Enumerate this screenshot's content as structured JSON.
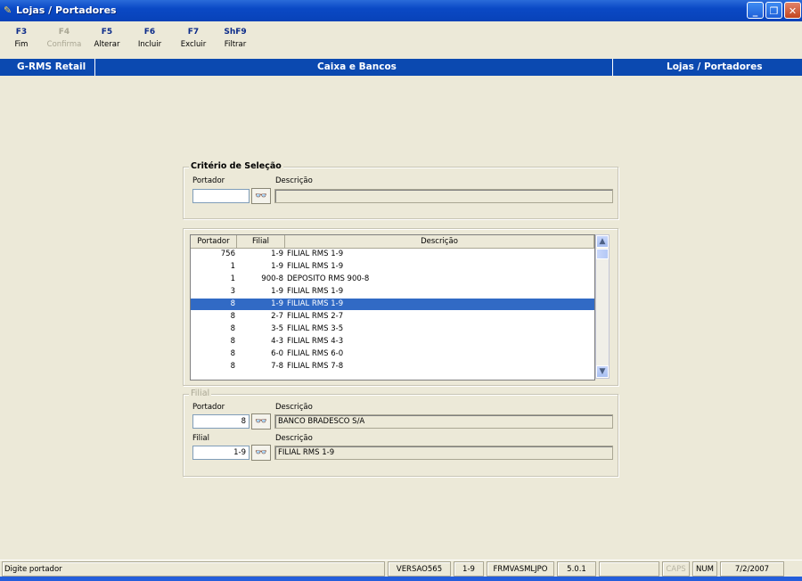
{
  "window": {
    "title": "Lojas / Portadores"
  },
  "toolbar": [
    {
      "key": "F3",
      "label": "Fim",
      "enabled": true
    },
    {
      "key": "F4",
      "label": "Confirma",
      "enabled": false
    },
    {
      "key": "F5",
      "label": "Alterar",
      "enabled": true
    },
    {
      "key": "F6",
      "label": "Incluir",
      "enabled": true
    },
    {
      "key": "F7",
      "label": "Excluir",
      "enabled": true
    },
    {
      "key": "ShF9",
      "label": "Filtrar",
      "enabled": true
    }
  ],
  "header": {
    "app": "G-RMS Retail",
    "module": "Caixa e Bancos",
    "screen": "Lojas / Portadores"
  },
  "criteria": {
    "title": "Critério de Seleção",
    "portador_label": "Portador",
    "portador_value": "",
    "descricao_label": "Descrição",
    "descricao_value": ""
  },
  "grid": {
    "columns": [
      "Portador",
      "Filial",
      "Descrição"
    ],
    "rows": [
      {
        "portador": "756",
        "filial": "1-9",
        "descricao": "FILIAL RMS 1-9"
      },
      {
        "portador": "1",
        "filial": "1-9",
        "descricao": "FILIAL RMS 1-9"
      },
      {
        "portador": "1",
        "filial": "900-8",
        "descricao": "DEPOSITO RMS 900-8"
      },
      {
        "portador": "3",
        "filial": "1-9",
        "descricao": "FILIAL RMS 1-9"
      },
      {
        "portador": "8",
        "filial": "1-9",
        "descricao": "FILIAL RMS 1-9"
      },
      {
        "portador": "8",
        "filial": "2-7",
        "descricao": "FILIAL RMS 2-7"
      },
      {
        "portador": "8",
        "filial": "3-5",
        "descricao": "FILIAL RMS 3-5"
      },
      {
        "portador": "8",
        "filial": "4-3",
        "descricao": "FILIAL RMS 4-3"
      },
      {
        "portador": "8",
        "filial": "6-0",
        "descricao": "FILIAL RMS 6-0"
      },
      {
        "portador": "8",
        "filial": "7-8",
        "descricao": "FILIAL RMS 7-8"
      }
    ],
    "selected_index": 4
  },
  "filial": {
    "title": "Filial",
    "portador_label": "Portador",
    "portador_value": "8",
    "portador_desc_label": "Descrição",
    "portador_desc_value": "BANCO BRADESCO S/A",
    "filial_label": "Filial",
    "filial_value": "1-9",
    "filial_desc_label": "Descrição",
    "filial_desc_value": "FILIAL RMS 1-9"
  },
  "status": {
    "message": "Digite portador",
    "version": "VERSAO565",
    "filial": "1-9",
    "form": "FRMVASMLJPO",
    "build": "5.0.1",
    "caps": "CAPS",
    "num": "NUM",
    "date": "7/2/2007"
  }
}
